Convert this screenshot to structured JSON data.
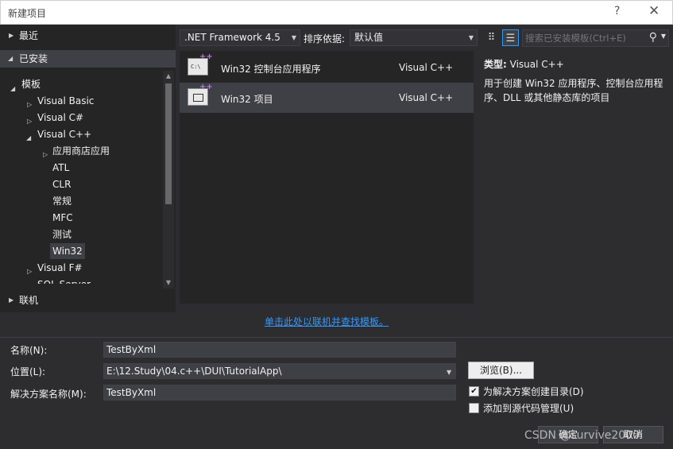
{
  "window": {
    "title": "新建项目",
    "help": "?",
    "close": "✕"
  },
  "left": {
    "recent": "最近",
    "installed": "已安装",
    "online": "联机",
    "tree": {
      "templates": "模板",
      "visual_basic": "Visual Basic",
      "visual_csharp": "Visual C#",
      "visual_cpp": "Visual C++",
      "store_apps": "应用商店应用",
      "atl": "ATL",
      "clr": "CLR",
      "general": "常规",
      "mfc": "MFC",
      "test": "测试",
      "win32": "Win32",
      "visual_fsharp": "Visual F#",
      "sql_server": "SQL Server"
    }
  },
  "toolbar": {
    "framework": ".NET Framework 4.5",
    "sort_label": "排序依据:",
    "sort_value": "默认值",
    "search_placeholder": "搜索已安装模板(Ctrl+E)"
  },
  "templates": [
    {
      "name": "Win32 控制台应用程序",
      "lang": "Visual C++",
      "icon_text": "C:\\"
    },
    {
      "name": "Win32 项目",
      "lang": "Visual C++"
    }
  ],
  "description": {
    "type_label": "类型:",
    "type_value": "Visual C++",
    "text": "用于创建 Win32 应用程序、控制台应用程序、DLL 或其他静态库的项目"
  },
  "online_link": "单击此处以联机并查找模板。",
  "form": {
    "name_label": "名称(N):",
    "name_value": "TestByXml",
    "location_label": "位置(L):",
    "location_value": "E:\\12.Study\\04.c++\\DUI\\TutorialApp\\",
    "solution_label": "解决方案名称(M):",
    "solution_value": "TestByXml",
    "browse": "浏览(B)...",
    "create_dir": "为解决方案创建目录(D)",
    "add_source_control": "添加到源代码管理(U)",
    "ok": "确定",
    "cancel": "取消"
  },
  "watermark": "CSDN @survive2000"
}
